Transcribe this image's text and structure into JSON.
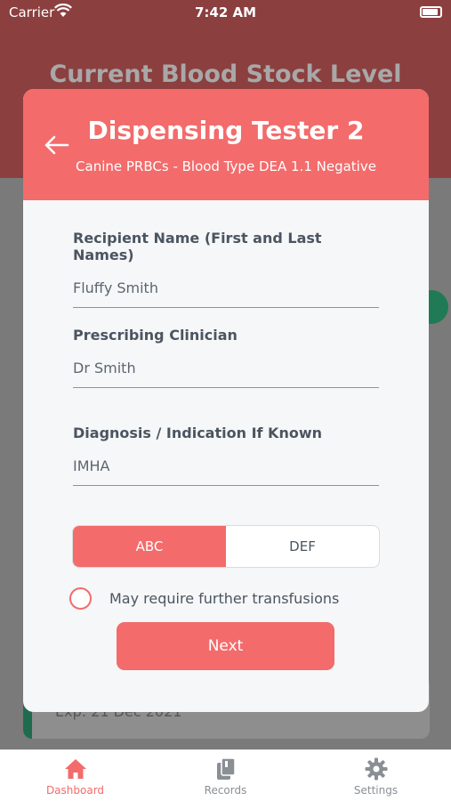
{
  "status_bar": {
    "carrier": "Carrier",
    "time": "7:42 AM"
  },
  "background": {
    "title": "Current Blood Stock Level",
    "card_text": "Exp: 21 Dec 2021"
  },
  "modal": {
    "title": "Dispensing Tester 2",
    "subtitle": "Canine PRBCs - Blood Type DEA 1.1 Negative",
    "fields": [
      {
        "label": "Recipient Name (First and Last Names)",
        "value": "Fluffy Smith"
      },
      {
        "label": "Prescribing Clinician",
        "value": "Dr Smith"
      },
      {
        "label": "Diagnosis / Indication If Known",
        "value": "IMHA"
      }
    ],
    "segments": [
      {
        "label": "ABC",
        "selected": true
      },
      {
        "label": "DEF",
        "selected": false
      }
    ],
    "checkbox_label": "May require further transfusions",
    "next_label": "Next"
  },
  "tabs": [
    {
      "label": "Dashboard",
      "icon": "home-icon",
      "active": true
    },
    {
      "label": "Records",
      "icon": "book-icon",
      "active": false
    },
    {
      "label": "Settings",
      "icon": "gear-icon",
      "active": false
    }
  ],
  "colors": {
    "accent": "#f36b6b",
    "text": "#4b5560"
  }
}
